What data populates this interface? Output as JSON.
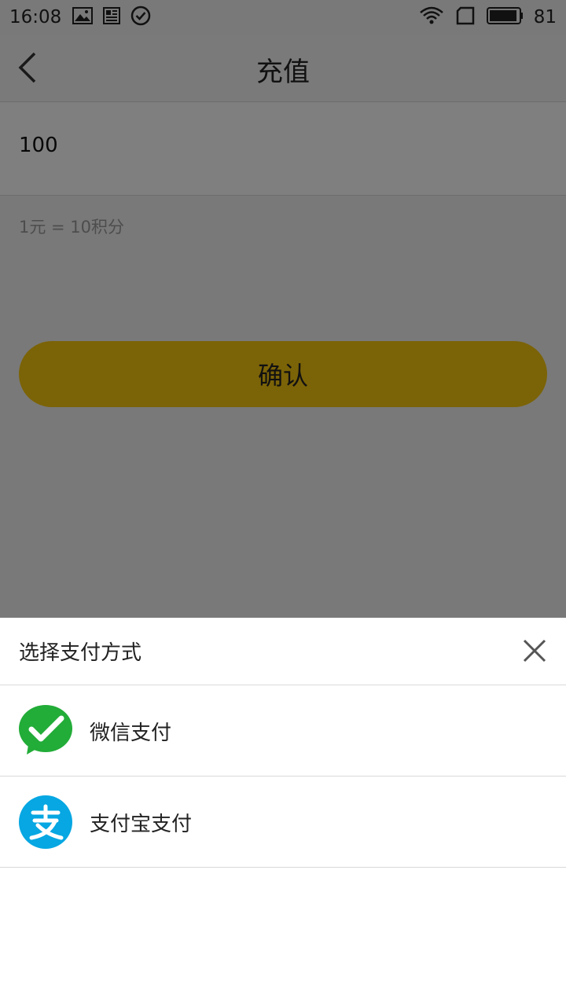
{
  "status_bar": {
    "time": "16:08",
    "battery": "81",
    "icons": [
      "image-icon",
      "news-icon",
      "check-circle-icon",
      "wifi-icon",
      "sim-icon",
      "battery-icon"
    ]
  },
  "nav": {
    "title": "充值",
    "back_icon": "chevron-left-icon"
  },
  "recharge": {
    "amount_value": "100",
    "rate_text": "1元 = 10积分",
    "confirm_label": "确认"
  },
  "colors": {
    "accent": "#f6c60e",
    "wechat": "#22ac38",
    "alipay": "#06a7e2"
  },
  "payment_sheet": {
    "title": "选择支付方式",
    "close_icon": "close-icon",
    "options": [
      {
        "label": "微信支付",
        "icon": "wechat-pay-icon"
      },
      {
        "label": "支付宝支付",
        "icon": "alipay-icon"
      }
    ]
  }
}
